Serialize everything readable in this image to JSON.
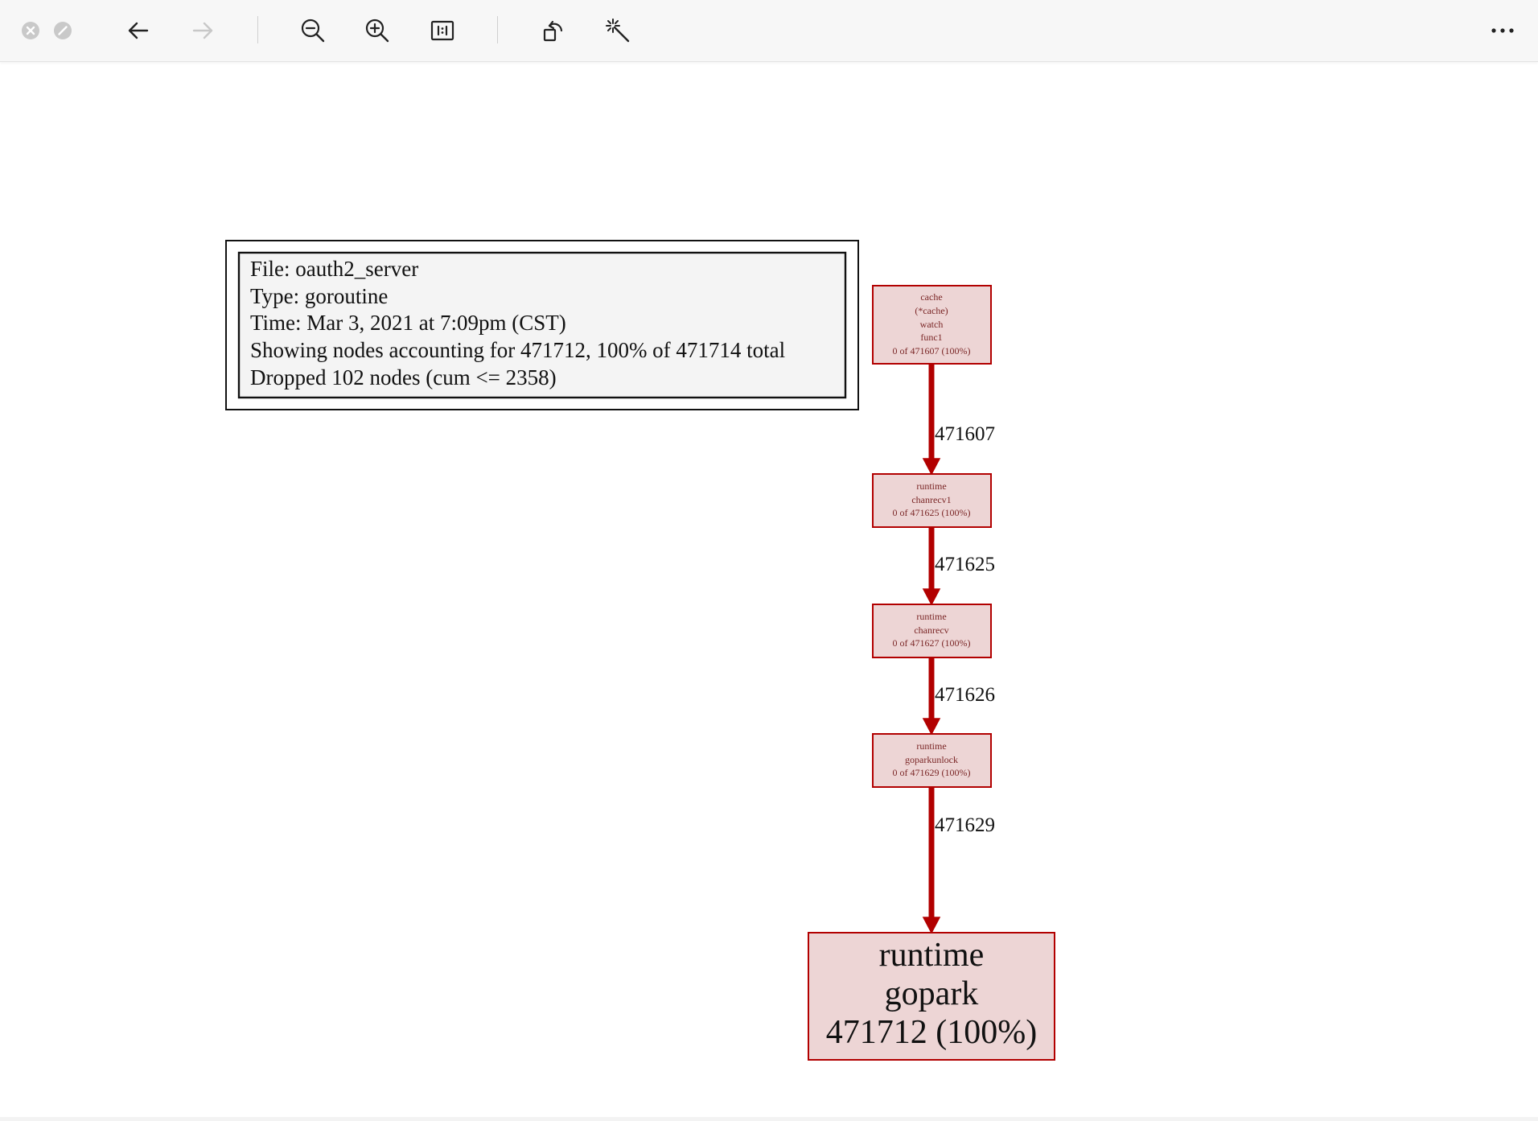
{
  "toolbar": {
    "close_window": "close-icon",
    "minimize_window": "minimize-icon",
    "back": "arrow-left-icon",
    "forward": "arrow-right-icon",
    "zoom_out": "zoom-out-icon",
    "zoom_in": "zoom-in-icon",
    "actual_size": "actual-size-icon",
    "rotate": "rotate-icon",
    "enhance": "magic-wand-icon",
    "more": "more-icon"
  },
  "legend": {
    "lines": [
      "File: oauth2_server",
      "Type: goroutine",
      "Time: Mar 3, 2021 at 7:09pm (CST)",
      "Showing nodes accounting for 471712, 100% of 471714 total",
      "Dropped 102 nodes (cum <= 2358)"
    ]
  },
  "graph": {
    "nodes": [
      {
        "id": "n1",
        "lines": [
          "cache",
          "(*cache)",
          "watch",
          "func1",
          "0 of 471607 (100%)"
        ]
      },
      {
        "id": "n2",
        "lines": [
          "runtime",
          "chanrecv1",
          "0 of 471625 (100%)"
        ]
      },
      {
        "id": "n3",
        "lines": [
          "runtime",
          "chanrecv",
          "0 of 471627 (100%)"
        ]
      },
      {
        "id": "n4",
        "lines": [
          "runtime",
          "goparkunlock",
          "0 of 471629 (100%)"
        ]
      },
      {
        "id": "n5",
        "lines": [
          "runtime",
          "gopark",
          "471712 (100%)"
        ]
      }
    ],
    "edges": [
      {
        "from": "n1",
        "to": "n2",
        "label": "471607"
      },
      {
        "from": "n2",
        "to": "n3",
        "label": "471625"
      },
      {
        "from": "n3",
        "to": "n4",
        "label": "471626"
      },
      {
        "from": "n4",
        "to": "n5",
        "label": "471629"
      }
    ],
    "colors": {
      "node_fill": "#edd5d5",
      "node_stroke": "#b20000",
      "edge": "#b20000",
      "small_text": "#7a2626"
    }
  }
}
